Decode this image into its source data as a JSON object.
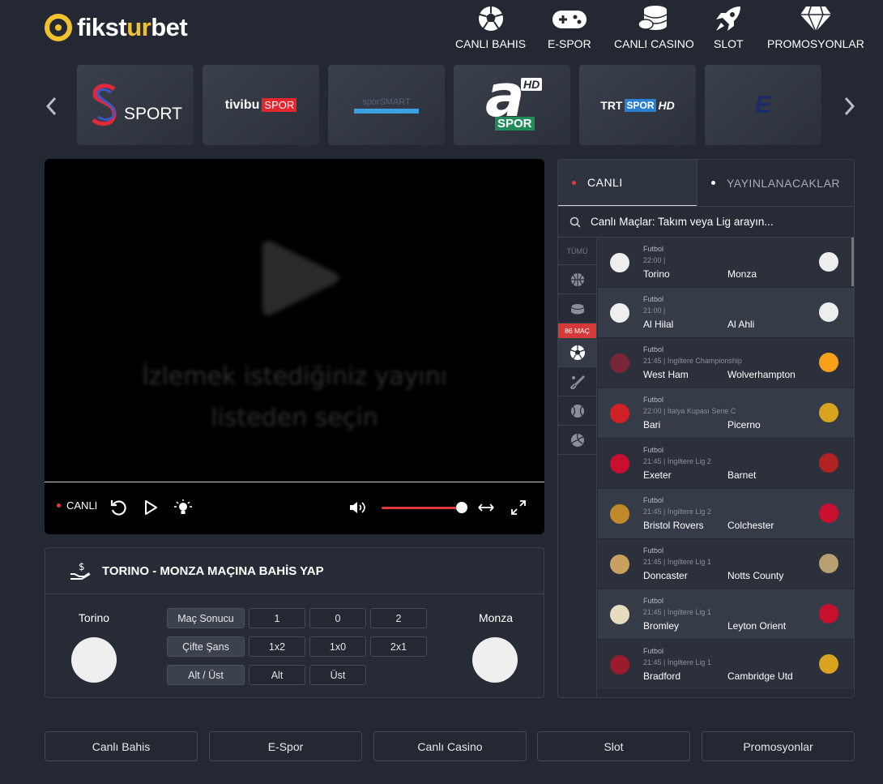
{
  "brand": {
    "part1": "fikst",
    "part2": "ur",
    "part3": "bet"
  },
  "nav": [
    {
      "label": "CANLI BAHIS",
      "icon": "soccer-ball-icon"
    },
    {
      "label": "E-SPOR",
      "icon": "gamepad-icon"
    },
    {
      "label": "CANLI CASINO",
      "icon": "coins-icon"
    },
    {
      "label": "SLOT",
      "icon": "rocket-icon"
    },
    {
      "label": "PROMOSYONLAR",
      "icon": "diamond-icon"
    }
  ],
  "channels": [
    {
      "name": "S SPORT",
      "sport_text": "SPORT"
    },
    {
      "name": "tivibu SPOR",
      "a": "tivibu",
      "b": "SPOR"
    },
    {
      "name": "spor smart",
      "a": "spor",
      "b": "SMART"
    },
    {
      "name": "a SPOR HD",
      "a": "a",
      "b": "SPOR",
      "c": "HD"
    },
    {
      "name": "TRT SPOR HD",
      "a": "TRT",
      "b": "SPOR",
      "c": "HD"
    },
    {
      "name": "Eurosport",
      "a": "E"
    }
  ],
  "player": {
    "message_line1": "İzlemek istediğiniz yayını",
    "message_line2": "listeden seçin",
    "live_label": "CANLI",
    "volume": 0.97
  },
  "bet": {
    "title": "TORINO - MONZA MAÇINA BAHİS YAP",
    "home_team": "Torino",
    "away_team": "Monza",
    "rows": [
      {
        "label": "Maç Sonucu",
        "options": [
          "1",
          "0",
          "2"
        ]
      },
      {
        "label": "Çifte Şans",
        "options": [
          "1x2",
          "1x0",
          "2x1"
        ]
      },
      {
        "label": "Alt / Üst",
        "options": [
          "Alt",
          "Üst"
        ]
      }
    ]
  },
  "panel": {
    "tab_live": "CANLI",
    "tab_upcoming": "YAYINLANACAKLAR",
    "search_placeholder": "Canlı Maçlar: Takım veya Lig arayın...",
    "all_label": "TÜMÜ",
    "count_badge": "86 MAÇ",
    "sport_filters": [
      "basketball-icon",
      "hockey-puck-icon",
      "soccer-ball-icon",
      "cricket-icon",
      "tennis-ball-icon",
      "volleyball-icon"
    ]
  },
  "matches": [
    {
      "sport": "Futbol",
      "info": "22:00 |",
      "home": "Torino",
      "away": "Monza",
      "home_color": "#eeeeee",
      "away_color": "#eeeeee"
    },
    {
      "sport": "Futbol",
      "info": "21:00 |",
      "home": "Al Hilal",
      "away": "Al Ahli",
      "home_color": "#eeeeee",
      "away_color": "#eeeeee"
    },
    {
      "sport": "Futbol",
      "info": "21:45 | İngiltere Championship",
      "home": "West Ham",
      "away": "Wolverhampton",
      "home_color": "#7a263a",
      "away_color": "#f9a01b"
    },
    {
      "sport": "Futbol",
      "info": "22:00 | İtalya Kupası Serie C",
      "home": "Bari",
      "away": "Picerno",
      "home_color": "#d22027",
      "away_color": "#d9a21f"
    },
    {
      "sport": "Futbol",
      "info": "21:45 | İngiltere Lig 2",
      "home": "Exeter",
      "away": "Barnet",
      "home_color": "#c8102e",
      "away_color": "#b22222"
    },
    {
      "sport": "Futbol",
      "info": "21:45 | İngiltere Lig 2",
      "home": "Bristol Rovers",
      "away": "Colchester",
      "home_color": "#c08a2a",
      "away_color": "#c8102e"
    },
    {
      "sport": "Futbol",
      "info": "21:45 | İngiltere Lig 1",
      "home": "Doncaster",
      "away": "Notts County",
      "home_color": "#c8a060",
      "away_color": "#b8a070"
    },
    {
      "sport": "Futbol",
      "info": "21:45 | İngiltere Lig 1",
      "home": "Bromley",
      "away": "Leyton Orient",
      "home_color": "#e8dcc0",
      "away_color": "#c8102e"
    },
    {
      "sport": "Futbol",
      "info": "21:45 | İngiltere Lig 1",
      "home": "Bradford",
      "away": "Cambridge Utd",
      "home_color": "#9a1b2b",
      "away_color": "#d9a21f"
    }
  ],
  "footer": [
    "Canlı Bahis",
    "E-Spor",
    "Canlı Casino",
    "Slot",
    "Promosyonlar"
  ],
  "colors": {
    "brand_yellow": "#f2c12e",
    "live_red": "#e03a3a",
    "background": "#232833"
  }
}
